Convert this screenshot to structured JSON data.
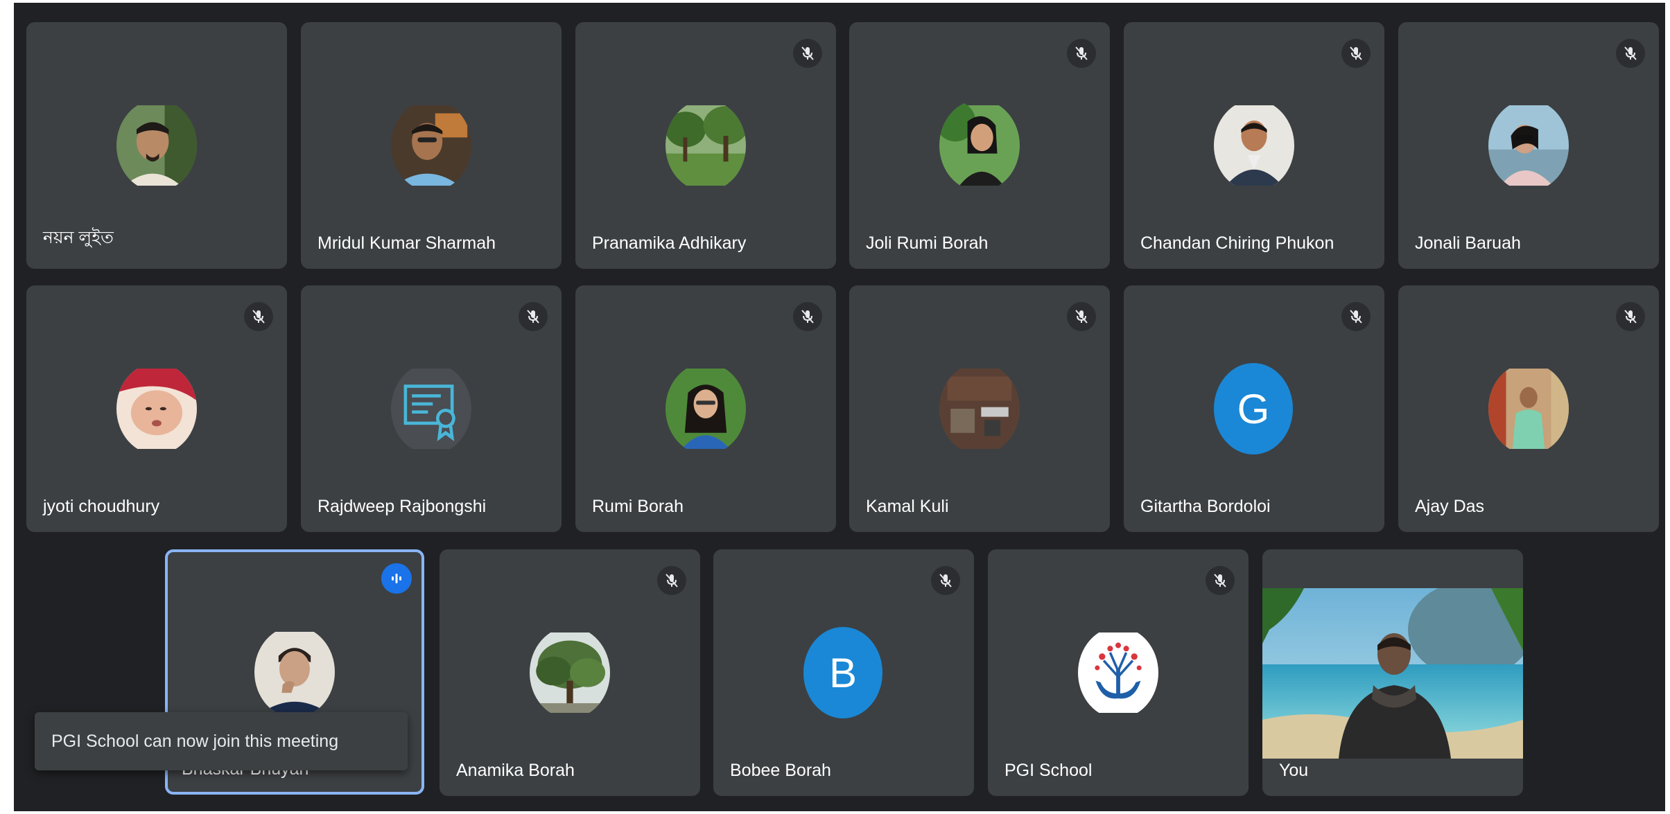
{
  "participants": [
    {
      "name": "নয়ন লুইত",
      "muted": false,
      "avatar": "photo-man-selfie"
    },
    {
      "name": "Mridul Kumar Sharmah",
      "muted": false,
      "avatar": "photo-man-smiling"
    },
    {
      "name": "Pranamika Adhikary",
      "muted": true,
      "avatar": "photo-landscape-trees"
    },
    {
      "name": "Joli Rumi Borah",
      "muted": true,
      "avatar": "photo-woman-garden"
    },
    {
      "name": "Chandan Chiring Phukon",
      "muted": true,
      "avatar": "photo-man-suit"
    },
    {
      "name": "Jonali Baruah",
      "muted": true,
      "avatar": "photo-woman-sunglasses"
    },
    {
      "name": "jyoti choudhury",
      "muted": true,
      "avatar": "photo-baby"
    },
    {
      "name": "Rajdweep Rajbongshi",
      "muted": true,
      "avatar": "certificate-icon"
    },
    {
      "name": "Rumi Borah",
      "muted": true,
      "avatar": "photo-woman-glasses"
    },
    {
      "name": "Kamal Kuli",
      "muted": true,
      "avatar": "photo-dark-objects"
    },
    {
      "name": "Gitartha Bordoloi",
      "muted": true,
      "avatar_letter": "G",
      "avatar_color": "#1a88d6"
    },
    {
      "name": "Ajay Das",
      "muted": true,
      "avatar": "photo-man-festival"
    },
    {
      "name": "Bhaskar Bhuyan",
      "muted": false,
      "speaking": true,
      "avatar": "photo-man-thinking"
    },
    {
      "name": "Anamika Borah",
      "muted": true,
      "avatar": "photo-tree"
    },
    {
      "name": "Bobee Borah",
      "muted": true,
      "avatar_letter": "B",
      "avatar_color": "#1a88d6"
    },
    {
      "name": "PGI School",
      "muted": true,
      "avatar": "tree-hands-logo"
    },
    {
      "name": "You",
      "muted": false,
      "video": true
    }
  ],
  "toast": {
    "message": "PGI School can now join this meeting"
  },
  "colors": {
    "background": "#202124",
    "tile": "#3c4043",
    "speaking_border": "#8ab4f8",
    "accent": "#1a73e8"
  }
}
